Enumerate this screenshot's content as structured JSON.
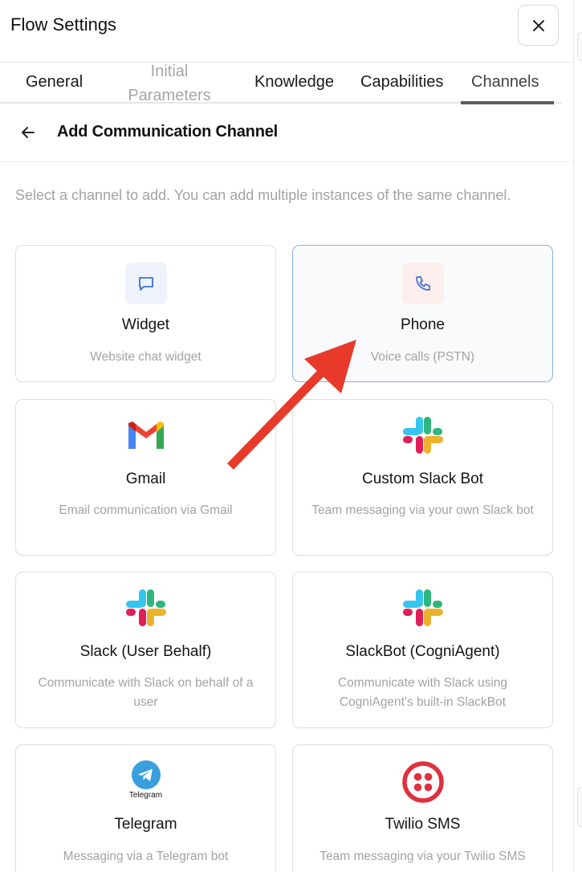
{
  "window": {
    "title": "Flow Settings"
  },
  "tabs": [
    {
      "label": "General"
    },
    {
      "label": "Initial Parameters"
    },
    {
      "label": "Knowledge"
    },
    {
      "label": "Capabilities"
    },
    {
      "label": "Channels",
      "active": true
    }
  ],
  "subheader": {
    "title": "Add Communication Channel"
  },
  "hint": "Select a channel to add. You can add multiple instances of the same channel.",
  "channels": [
    {
      "name": "Widget",
      "description": "Website chat widget",
      "icon": "chat-bubble-icon"
    },
    {
      "name": "Phone",
      "description": "Voice calls (PSTN)",
      "icon": "phone-icon",
      "selected": true
    },
    {
      "name": "Gmail",
      "description": "Email communication via Gmail",
      "icon": "gmail-icon"
    },
    {
      "name": "Custom Slack Bot",
      "description": "Team messaging via your own Slack bot",
      "icon": "slack-icon"
    },
    {
      "name": "Slack (User Behalf)",
      "description": "Communicate with Slack on behalf of a user",
      "icon": "slack-icon"
    },
    {
      "name": "SlackBot (CogniAgent)",
      "description": "Communicate with Slack using CogniAgent's built-in SlackBot",
      "icon": "slack-icon"
    },
    {
      "name": "Telegram",
      "description": "Messaging via a Telegram bot",
      "icon": "telegram-icon",
      "icon_caption": "Telegram"
    },
    {
      "name": "Twilio SMS",
      "description": "Team messaging via your Twilio SMS",
      "icon": "twilio-icon"
    }
  ],
  "colors": {
    "accent_border": "#8bb0dd",
    "annotation_arrow": "#e83a2a",
    "widget_icon": "#3b6fd6",
    "phone_icon": "#3b6fd6",
    "telegram": "#3a9fde",
    "twilio": "#e0303e"
  }
}
